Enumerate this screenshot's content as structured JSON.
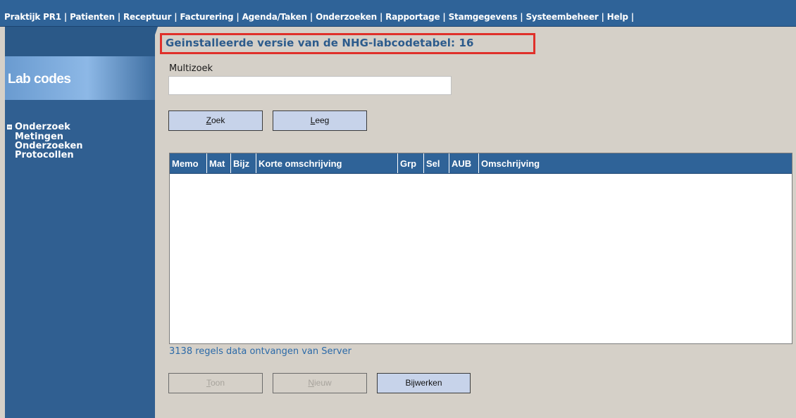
{
  "menu": {
    "items": [
      "Praktijk PR1",
      "Patienten",
      "Receptuur",
      "Facturering",
      "Agenda/Taken",
      "Onderzoeken",
      "Rapportage",
      "Stamgegevens",
      "Systeembeheer",
      "Help"
    ],
    "separator": "|"
  },
  "sidebar": {
    "title": "Lab codes",
    "root": "Onderzoek",
    "items": [
      "Metingen",
      "Onderzoeken",
      "Protocollen"
    ]
  },
  "main": {
    "heading": "Geinstalleerde versie van de NHG-labcodetabel:  16",
    "highlight_color": "#e0302a",
    "search": {
      "label": "Multizoek",
      "value": "",
      "placeholder": ""
    },
    "buttons": {
      "zoek": {
        "accel": "Z",
        "rest": "oek"
      },
      "leeg": {
        "accel": "L",
        "rest": "eeg"
      }
    },
    "grid": {
      "columns": [
        "Memo",
        "Mat",
        "Bijz",
        "Korte omschrijving",
        "Grp",
        "Sel",
        "AUB",
        "Omschrijving"
      ],
      "rows": []
    },
    "status": "3138 regels data ontvangen van Server",
    "footer_buttons": {
      "toon": {
        "accel": "T",
        "rest": "oon",
        "enabled": false
      },
      "nieuw": {
        "accel": "N",
        "rest": "ieuw",
        "enabled": false
      },
      "bijwerken": {
        "label": "Bijwerken",
        "enabled": true
      }
    }
  },
  "colors": {
    "nav_blue": "#2f6398",
    "sidebar_blue": "#305f91",
    "background": "#d5d0c8",
    "button_blue": "#c7d3ea"
  }
}
